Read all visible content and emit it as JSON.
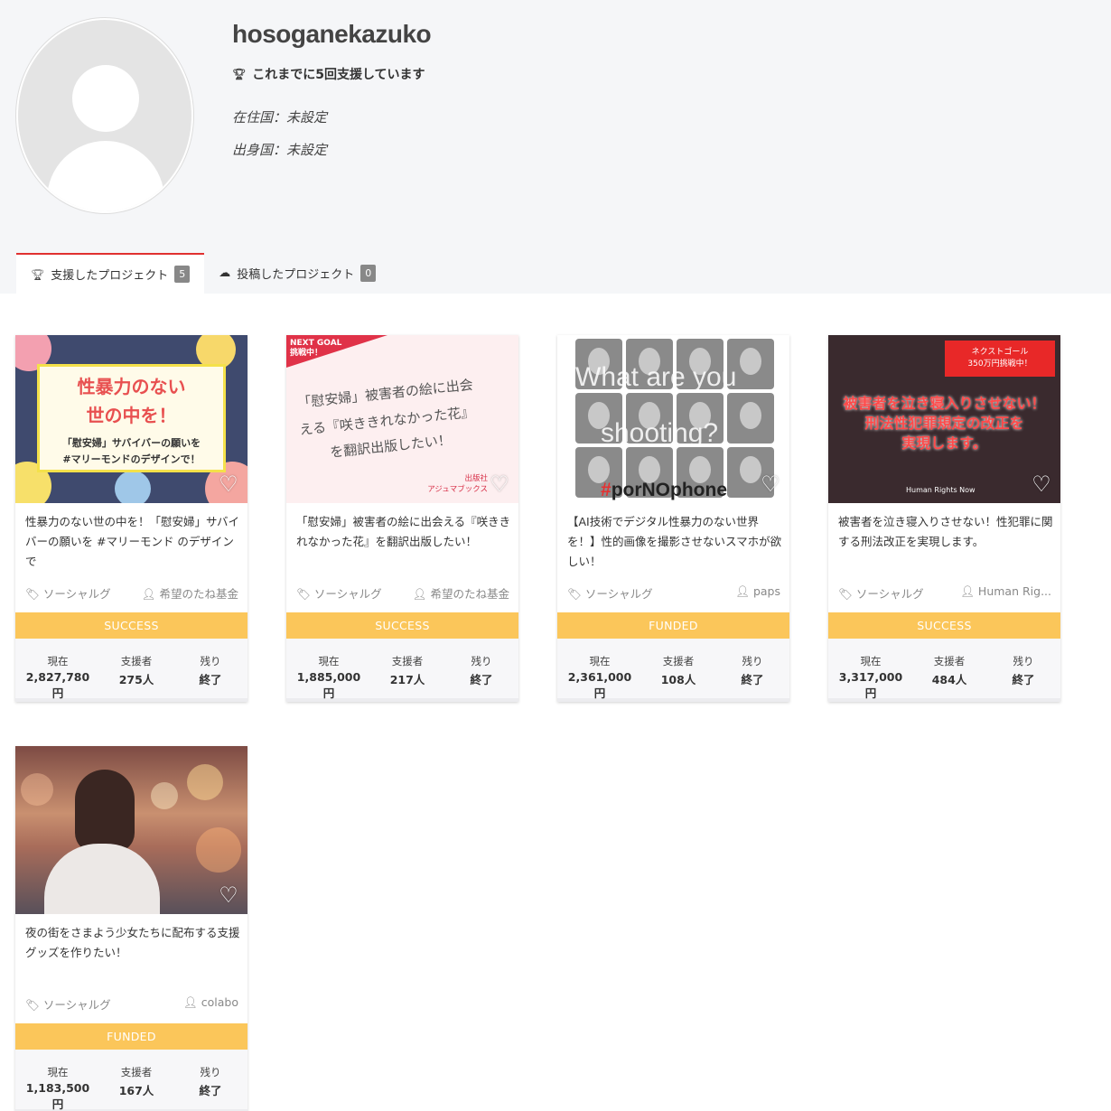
{
  "profile": {
    "username": "hosoganekazuko",
    "support_count": "これまでに5回支援しています",
    "residence": "在住国：未設定",
    "birthplace": "出身国：未設定"
  },
  "tabs": [
    {
      "label": "支援したプロジェクト",
      "count": "5"
    },
    {
      "label": "投稿したプロジェクト",
      "count": "0"
    }
  ],
  "stat_labels": {
    "current": "現在",
    "supporters": "支援者",
    "remaining": "残り"
  },
  "colors": {
    "status_bar": "#fbc65a",
    "active_tab": "#e03030"
  },
  "cards": [
    {
      "title": "性暴力のない世の中を！「慰安婦」サバイバーの願いを #マリーモンド のデザインで",
      "category": "ソーシャルグ",
      "owner": "希望のたね基金",
      "status": "SUCCESS",
      "current": "2,827,780円",
      "supporters": "275人",
      "remaining": "終了",
      "thumb": {
        "big1": "性暴力のない",
        "big2": "世の中を！",
        "small1": "「慰安婦」サバイバーの願いを",
        "small2": "#マリーモンドのデザインで！"
      }
    },
    {
      "title": "「慰安婦」被害者の絵に出会える『咲ききれなかった花』を翻訳出版したい！",
      "category": "ソーシャルグ",
      "owner": "希望のたね基金",
      "status": "SUCCESS",
      "current": "1,885,000円",
      "supporters": "217人",
      "remaining": "終了",
      "thumb": {
        "band1": "NEXT GOAL",
        "band2": "挑戦中！",
        "line1": "「慰安婦」被害者の絵に出会",
        "line2": "える『咲ききれなかった花』",
        "line3": "を翻訳出版したい！",
        "pub1": "出版社",
        "pub2": "アジュマブックス"
      }
    },
    {
      "title": "【AI技術でデジタル性暴力のない世界を！】性的画像を撮影させないスマホが欲しい！",
      "category": "ソーシャルグ",
      "owner": "paps",
      "status": "FUNDED",
      "current": "2,361,000円",
      "supporters": "108人",
      "remaining": "終了",
      "thumb": {
        "overlay1": "What are you",
        "overlay2": "shooting?",
        "hash": "#",
        "tag": "porNOphone"
      }
    },
    {
      "title": "被害者を泣き寝入りさせない！性犯罪に関する刑法改正を実現します。",
      "category": "ソーシャルグ",
      "owner": "Human Rig...",
      "status": "SUCCESS",
      "current": "3,317,000円",
      "supporters": "484人",
      "remaining": "終了",
      "thumb": {
        "box1": "ネクストゴール",
        "box2": "350万円挑戦中！",
        "h1": "被害者を泣き寝入りさせない！",
        "h2": "刑法性犯罪規定の改正を",
        "h3": "実現します。",
        "logo": "Human Rights Now"
      }
    },
    {
      "title": "夜の街をさまよう少女たちに配布する支援グッズを作りたい！",
      "category": "ソーシャルグ",
      "owner": "colabo",
      "status": "FUNDED",
      "current": "1,183,500円",
      "supporters": "167人",
      "remaining": "終了",
      "thumb": {}
    }
  ]
}
